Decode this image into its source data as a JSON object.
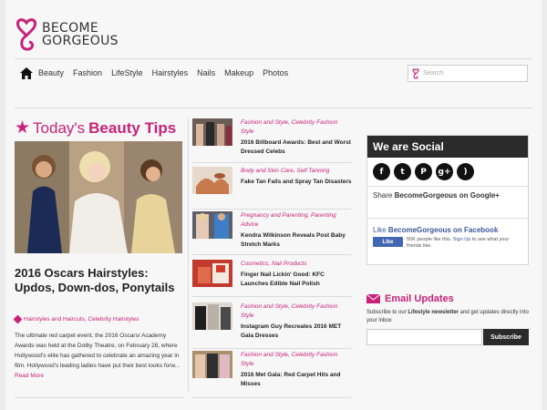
{
  "brand": {
    "line1": "BECOME",
    "line2": "GORGEOUS",
    "accent": "#c8227a"
  },
  "nav": {
    "home_icon": "home-icon",
    "items": [
      "Beauty",
      "Fashion",
      "LifeStyle",
      "Hairstyles",
      "Nails",
      "Makeup",
      "Photos"
    ],
    "search_placeholder": "Search"
  },
  "beauty_tips": {
    "title_a": "Today's",
    "title_b": "Beauty Tips"
  },
  "featured": {
    "title": "2016 Oscars Hairstyles: Updos, Down-dos, Ponytails",
    "tags": "Hairstyles and Haircuts, Celebrity Hairstyles",
    "excerpt": "The ultimate red carpet event, the 2016 Oscars/ Academy Awards was held at the Dolby Theatre, on February 28, where Hollywood's elite has gathered to celebrate an amazing year in film. Hollywood's leading ladies have put their best looks forw...",
    "read_more": "Read More"
  },
  "articles": [
    {
      "cats": "Fashion and Style, Celebrity Fashion Style",
      "headline": "2016 Billboard Awards: Best and Worst Dressed Celebs"
    },
    {
      "cats": "Body and Skin Care, Self Tanning",
      "headline": "Fake Tan Fails and Spray Tan Disasters"
    },
    {
      "cats": "Pregnancy and Parenting, Parenting Advice",
      "headline": "Kendra Wilkinson Reveals Post Baby Stretch Marks"
    },
    {
      "cats": "Cosmetics, Nail Products",
      "headline": "Finger Nail Lickin' Good: KFC Launches Edible Nail Polish"
    },
    {
      "cats": "Fashion and Style, Celebrity Fashion Style",
      "headline": "Instagram Guy Recreates 2016 MET Gala Dresses"
    },
    {
      "cats": "Fashion and Style, Celebrity Fashion Style",
      "headline": "2016 Met Gala: Red Carpet Hits and Misses"
    }
  ],
  "social": {
    "title": "We are Social",
    "icons": [
      "facebook-icon",
      "twitter-icon",
      "pinterest-icon",
      "google-plus-icon",
      "rss-icon"
    ],
    "share_prefix": "Share",
    "share_target": "BecomeGorgeous on Google+",
    "fb_like_prefix": "Like",
    "fb_like_target": "BecomeGorgeous on Facebook",
    "fb_button": "Like",
    "fb_count_a": "55K people like this.",
    "fb_signup": "Sign Up",
    "fb_count_b": "to see what your friends like."
  },
  "email": {
    "title": "Email Updates",
    "text_a": "Subscribe to our",
    "text_bold": "Lifestyle newsletter",
    "text_b": "and get updates directly into your inbox",
    "button": "Subscribe"
  }
}
